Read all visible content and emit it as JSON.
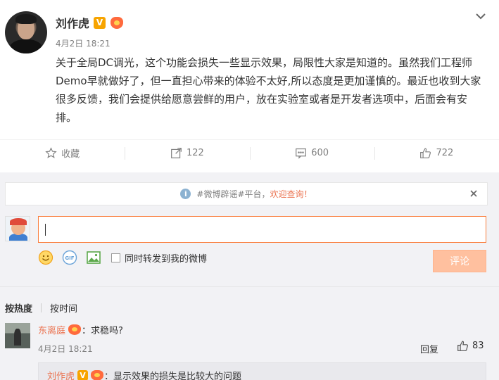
{
  "post": {
    "author": "刘作虎",
    "verified_badge": "V",
    "time": "4月2日 18:21",
    "text": "关于全局DC调光，这个功能会损失一些显示效果，局限性大家是知道的。虽然我们工程师Demo早就做好了，但一直担心带来的体验不太好,所以态度是更加谨慎的。最近也收到大家很多反馈，我们会提供给愿意尝鲜的用户，放在实验室或者是开发者选项中，后面会有安排。",
    "actions": {
      "favorite_label": "收藏",
      "repost_count": "122",
      "comment_count": "600",
      "like_count": "722"
    }
  },
  "notice": {
    "prefix": "#微博辟谣#平台，",
    "link": "欢迎查询！"
  },
  "compose": {
    "input_value": "",
    "repost_label": "同时转发到我的微博",
    "submit_label": "评论"
  },
  "sort": {
    "hot": "按热度",
    "time": "按时间"
  },
  "comment": {
    "author": "东离庭",
    "text": "：求稳吗?",
    "time": "4月2日 18:21",
    "reply_label": "回复",
    "like_count": "83"
  },
  "sub_reply": {
    "author": "刘作虎",
    "verified_badge": "V",
    "text": "：显示效果的损失是比较大的问题"
  },
  "colors": {
    "accent": "#eb7350",
    "verified": "#f7a400",
    "submit_disabled": "#ffc09f",
    "comments_bg": "#f2f2f5"
  }
}
